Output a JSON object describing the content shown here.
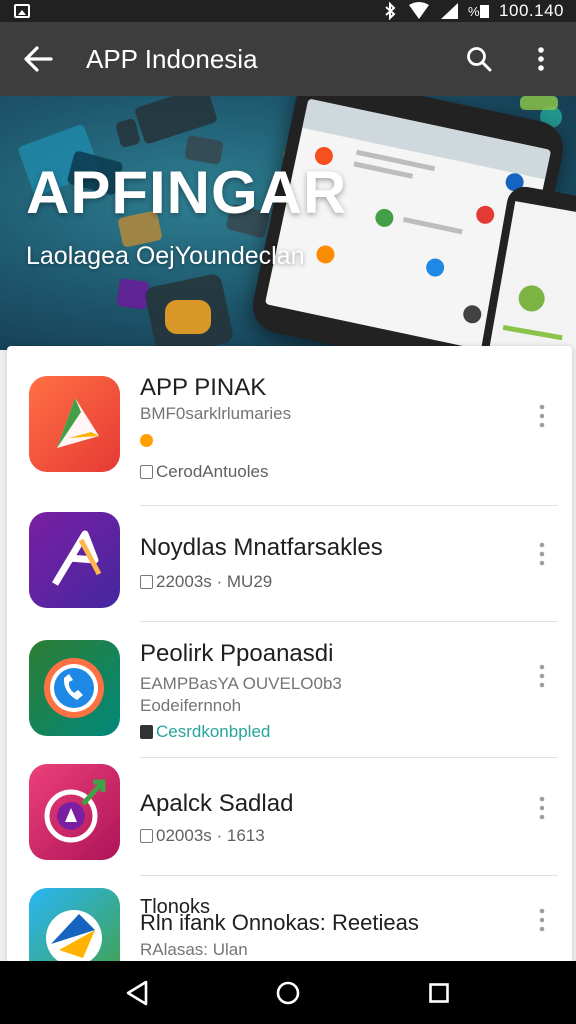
{
  "status_bar": {
    "time": "100.140"
  },
  "app_bar": {
    "title": "APP Indonesia",
    "icons": [
      "back-arrow-icon",
      "search-icon",
      "more-vert-icon"
    ]
  },
  "banner": {
    "title": "APFINGAR",
    "subtitle": "Laolagea OejYoundeclan"
  },
  "apps": [
    {
      "name": "APP PINAK",
      "subtitle": "BMF0sarklrlumaries",
      "meta": "CerodAntuoles",
      "colors": [
        "#ff6f00",
        "#e53935"
      ]
    },
    {
      "name": "Noydlas Mnatfarsakles",
      "meta": "22003s · MU29",
      "colors": [
        "#7b1fa2",
        "#4527a0"
      ]
    },
    {
      "name": "Peolirk Ppoanasdi",
      "subtitle": "EAMPBasYA OUVELO0b3",
      "subtitle2": "Eodeifernnoh",
      "meta": "Cesrdkonbpled",
      "colors": [
        "#2e7d32",
        "#00897b"
      ]
    },
    {
      "name": "Apalck Sadlad",
      "meta": "02003s · 1613",
      "colors": [
        "#e91e63",
        "#880e4f"
      ]
    },
    {
      "name": "Tlonoks",
      "name2": "Rln ifank Onnokas: Reetieas",
      "subtitle": "RAlasas: Ulan",
      "colors": [
        "#29b6f6",
        "#43a047"
      ]
    }
  ],
  "colors": {
    "app_bar": "#3d3d3d",
    "status_bar": "#212121",
    "nav_bar": "#000000",
    "accent_teal": "#26a69a"
  }
}
